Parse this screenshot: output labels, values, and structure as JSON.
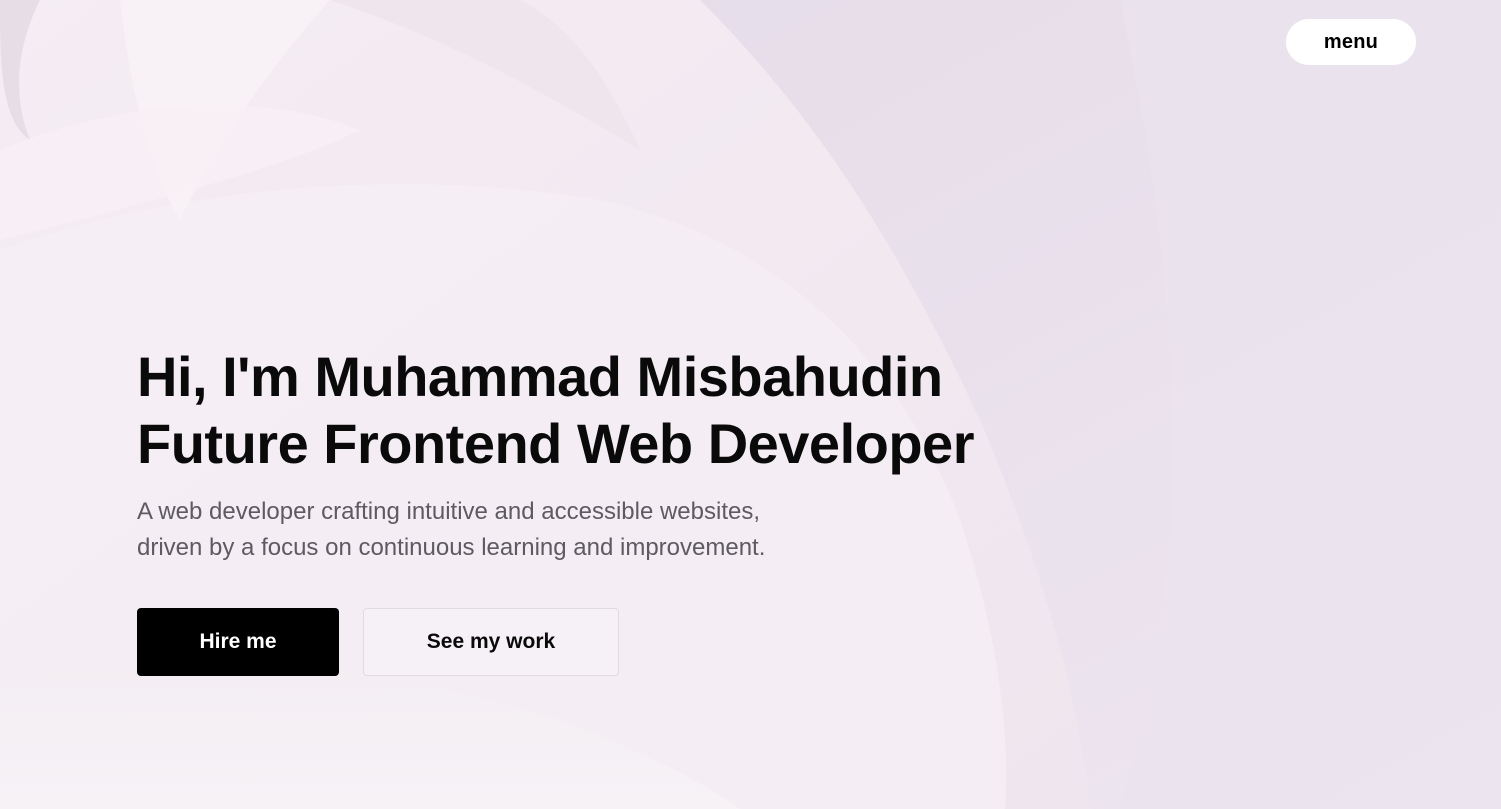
{
  "nav": {
    "menu_label": "menu"
  },
  "hero": {
    "heading_line1": "Hi, I'm Muhammad Misbahudin",
    "heading_line2": "Future Frontend Web Developer",
    "subtitle_line1": "A web developer crafting intuitive and accessible websites,",
    "subtitle_line2": "driven by a focus on continuous learning and improvement.",
    "primary_button": "Hire me",
    "secondary_button": "See my work"
  },
  "colors": {
    "background": "#efe6ee",
    "primary_button_bg": "#000000",
    "primary_button_text": "#ffffff",
    "heading_text": "#0a0a0a",
    "subtitle_text": "#5e5a62"
  }
}
